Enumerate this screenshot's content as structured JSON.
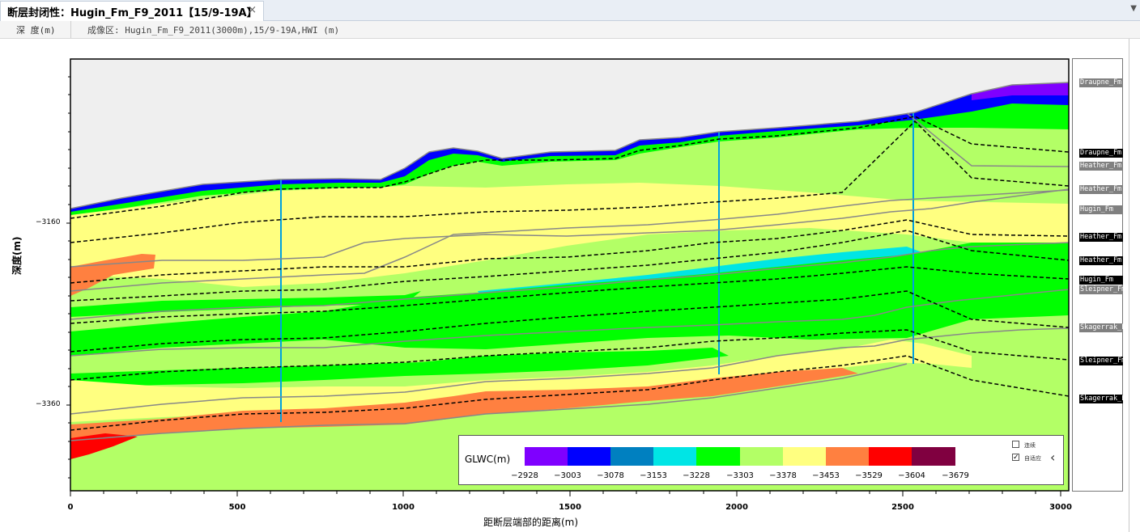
{
  "tab": {
    "title": "断层封闭性：Hugin_Fm_F9_2011【15/9-19A】",
    "close_icon": "×"
  },
  "header": {
    "depth_label": "深 度(m)",
    "image_label": "成像区: Hugin_Fm_F9_2011(3000m),15/9-19A,HWI (m)"
  },
  "plot": {
    "background": "#efefef",
    "x_label": "距断层端部的距离(m)",
    "y_label": "深度(m)",
    "x_ticks": [
      "0",
      "500",
      "1000",
      "1500",
      "2000",
      "2500",
      "3000"
    ],
    "y_ticks": [
      "−3160",
      "−3360"
    ]
  },
  "legend": {
    "title": "GLWC(m)",
    "colors": [
      "#7f00ff",
      "#0000ff",
      "#0080c0",
      "#00e5e5",
      "#00ff00",
      "#b3ff66",
      "#ffff80",
      "#ff8040",
      "#ff0000",
      "#800040"
    ],
    "ticks": [
      "−2928",
      "−3003",
      "−3078",
      "−3153",
      "−3228",
      "−3303",
      "−3378",
      "−3453",
      "−3529",
      "−3604",
      "−3679"
    ],
    "checkbox_1": {
      "label": "连续",
      "checked": false
    },
    "checkbox_2": {
      "label": "自适应",
      "checked": true
    },
    "collapse_icon": "‹"
  },
  "horizons": [
    {
      "label": "Draupne_Fm",
      "style": "gray"
    },
    {
      "label": "Draupne_Fm",
      "style": "black"
    },
    {
      "label": "Heather_Fm",
      "style": "gray"
    },
    {
      "label": "Heather_Fm",
      "style": "gray"
    },
    {
      "label": "Hugin_Fm",
      "style": "gray"
    },
    {
      "label": "Heather_Fm",
      "style": "black"
    },
    {
      "label": "Heather_Fm",
      "style": "black"
    },
    {
      "label": "Hugin_Fm",
      "style": "black"
    },
    {
      "label": "Sleipner_Fm",
      "style": "gray"
    },
    {
      "label": "Skagerrak_Fm",
      "style": "gray"
    },
    {
      "label": "Sleipner_Fm",
      "style": "black"
    },
    {
      "label": "Skagerrak_Fm",
      "style": "black"
    }
  ]
}
